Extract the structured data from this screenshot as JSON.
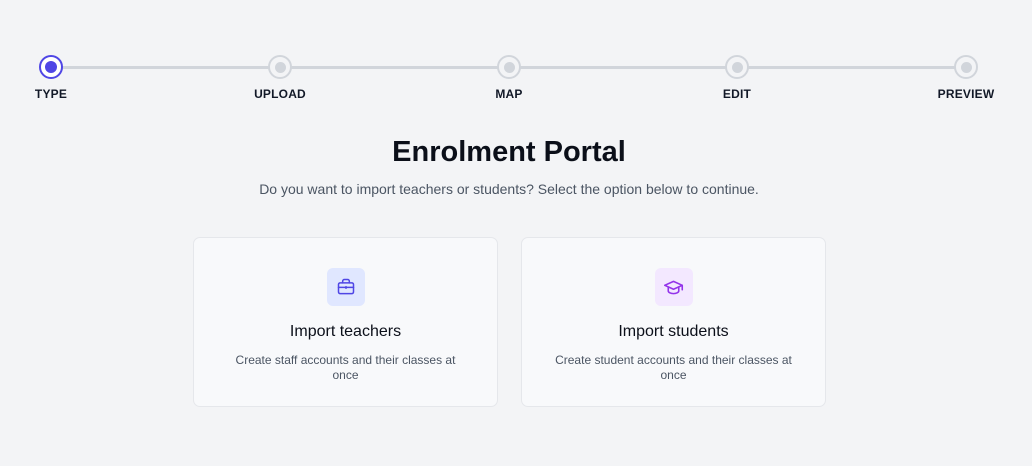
{
  "stepper": {
    "steps": [
      {
        "label": "TYPE",
        "state": "active"
      },
      {
        "label": "UPLOAD",
        "state": "pending"
      },
      {
        "label": "MAP",
        "state": "pending"
      },
      {
        "label": "EDIT",
        "state": "pending"
      },
      {
        "label": "PREVIEW",
        "state": "pending"
      }
    ]
  },
  "main": {
    "title": "Enrolment Portal",
    "subtitle": "Do you want to import teachers or students? Select the option below to continue."
  },
  "cards": [
    {
      "icon": "briefcase-icon",
      "title": "Import teachers",
      "description": "Create staff accounts and their classes at once",
      "icon_bg": "#e0e7ff",
      "icon_color": "#4f46e5"
    },
    {
      "icon": "graduation-cap-icon",
      "title": "Import students",
      "description": "Create student accounts and their classes at once",
      "icon_bg": "#f3e8ff",
      "icon_color": "#9333ea"
    }
  ],
  "colors": {
    "accent": "#4f46e5",
    "background": "#f3f4f6"
  }
}
